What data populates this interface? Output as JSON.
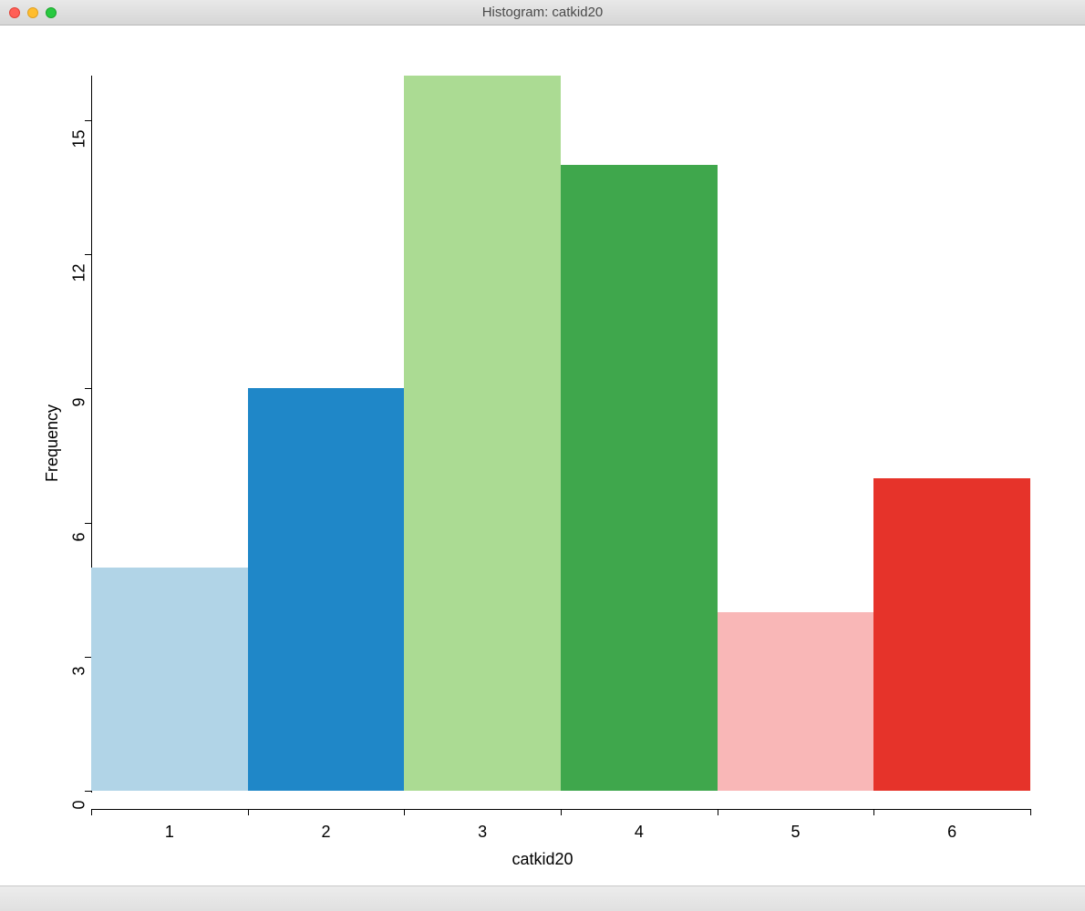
{
  "window": {
    "title": "Histogram: catkid20"
  },
  "chart_data": {
    "type": "bar",
    "categories": [
      "1",
      "2",
      "3",
      "4",
      "5",
      "6"
    ],
    "values": [
      5,
      9,
      16,
      14,
      4,
      7
    ],
    "colors": [
      "#b1d4e7",
      "#1f87c8",
      "#abdb93",
      "#3fa74c",
      "#f9b7b7",
      "#e6332a"
    ],
    "title": "",
    "xlabel": "catkid20",
    "ylabel": "Frequency",
    "ylim": [
      0,
      16
    ],
    "yticks": [
      0,
      3,
      6,
      9,
      12,
      15
    ],
    "xticks": [
      "1",
      "2",
      "3",
      "4",
      "5",
      "6"
    ]
  }
}
